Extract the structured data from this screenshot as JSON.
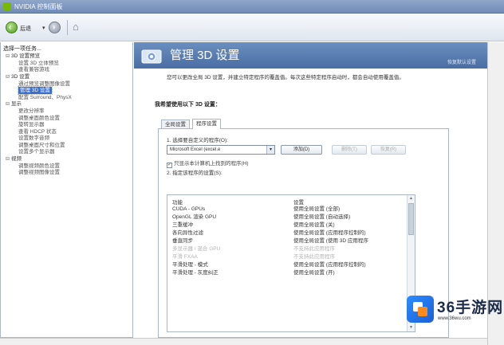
{
  "window": {
    "title": "NVIDIA 控制面板"
  },
  "toolbar": {
    "back_label": "后退",
    "dropdown": "▾"
  },
  "sidebar": {
    "header": "选择一项任务...",
    "items": [
      {
        "label": "3D 设置预览",
        "kind": "cat"
      },
      {
        "label": "设置 3D 立体预览",
        "kind": "child"
      },
      {
        "label": "查看兼容游戏",
        "kind": "child"
      },
      {
        "label": "3D 设置",
        "kind": "cat"
      },
      {
        "label": "通过预览调整图像设置",
        "kind": "child"
      },
      {
        "label": "管理 3D 设置",
        "kind": "sel"
      },
      {
        "label": "配置 Surround、PhysX",
        "kind": "child"
      },
      {
        "label": "显示",
        "kind": "cat"
      },
      {
        "label": "更改分辨率",
        "kind": "child"
      },
      {
        "label": "调整桌面颜色设置",
        "kind": "child"
      },
      {
        "label": "旋转显示器",
        "kind": "child"
      },
      {
        "label": "查看 HDCP 状态",
        "kind": "child"
      },
      {
        "label": "设置数字音频",
        "kind": "child"
      },
      {
        "label": "调整桌面尺寸和位置",
        "kind": "child"
      },
      {
        "label": "设置多个显示器",
        "kind": "child"
      },
      {
        "label": "视频",
        "kind": "cat"
      },
      {
        "label": "调整视频颜色设置",
        "kind": "child"
      },
      {
        "label": "调整视频图像设置",
        "kind": "child"
      }
    ]
  },
  "main": {
    "heading": "管理 3D 设置",
    "restore": "恢复默认设置",
    "intro": "您可以更改全局 3D 设置，并建立特定程序的覆盖值。每次这些特定程序启动时，都会自动使用覆盖值。",
    "subhead": "我希望使用以下 3D 设置：",
    "tabs": [
      "全局设置",
      "程序设置"
    ],
    "step1": "1. 选择要自定义的程序(O):",
    "program_selected": "Microsoft Excel (excel.e",
    "add_button": "添加(D)",
    "remove_button": "删除(T)",
    "restore_button": "恢复(R)",
    "show_only_checkbox": "只显示本计算机上找到的程序(H)",
    "step2": "2. 指定该程序的设置(S):",
    "col_feature": "功能",
    "col_setting": "设置",
    "rows": [
      {
        "feature": "CUDA - GPUs",
        "value": "使用全局设置 (全部)",
        "dim": false
      },
      {
        "feature": "OpenGL 渲染 GPU",
        "value": "使用全局设置 (自动选择)",
        "dim": false
      },
      {
        "feature": "三重缓冲",
        "value": "使用全局设置 (关)",
        "dim": false
      },
      {
        "feature": "各向异性过滤",
        "value": "使用全局设置 (应用程序控制的)",
        "dim": false
      },
      {
        "feature": "垂直同步",
        "value": "使用全局设置 (使用 3D 应用程序",
        "dim": false
      },
      {
        "feature": "多显示器 / 混合 GPU",
        "value": "不支持此应用程序",
        "dim": true
      },
      {
        "feature": "平滑 FXAA",
        "value": "不支持此应用程序",
        "dim": true
      },
      {
        "feature": "平滑处理 - 模式",
        "value": "使用全局设置 (应用程序控制的)",
        "dim": false
      },
      {
        "feature": "平滑处理 - 灰度纠正",
        "value": "使用全局设置 (开)",
        "dim": false
      }
    ]
  },
  "watermark": {
    "brand": "36手游网",
    "url": "www.36wu.com"
  }
}
